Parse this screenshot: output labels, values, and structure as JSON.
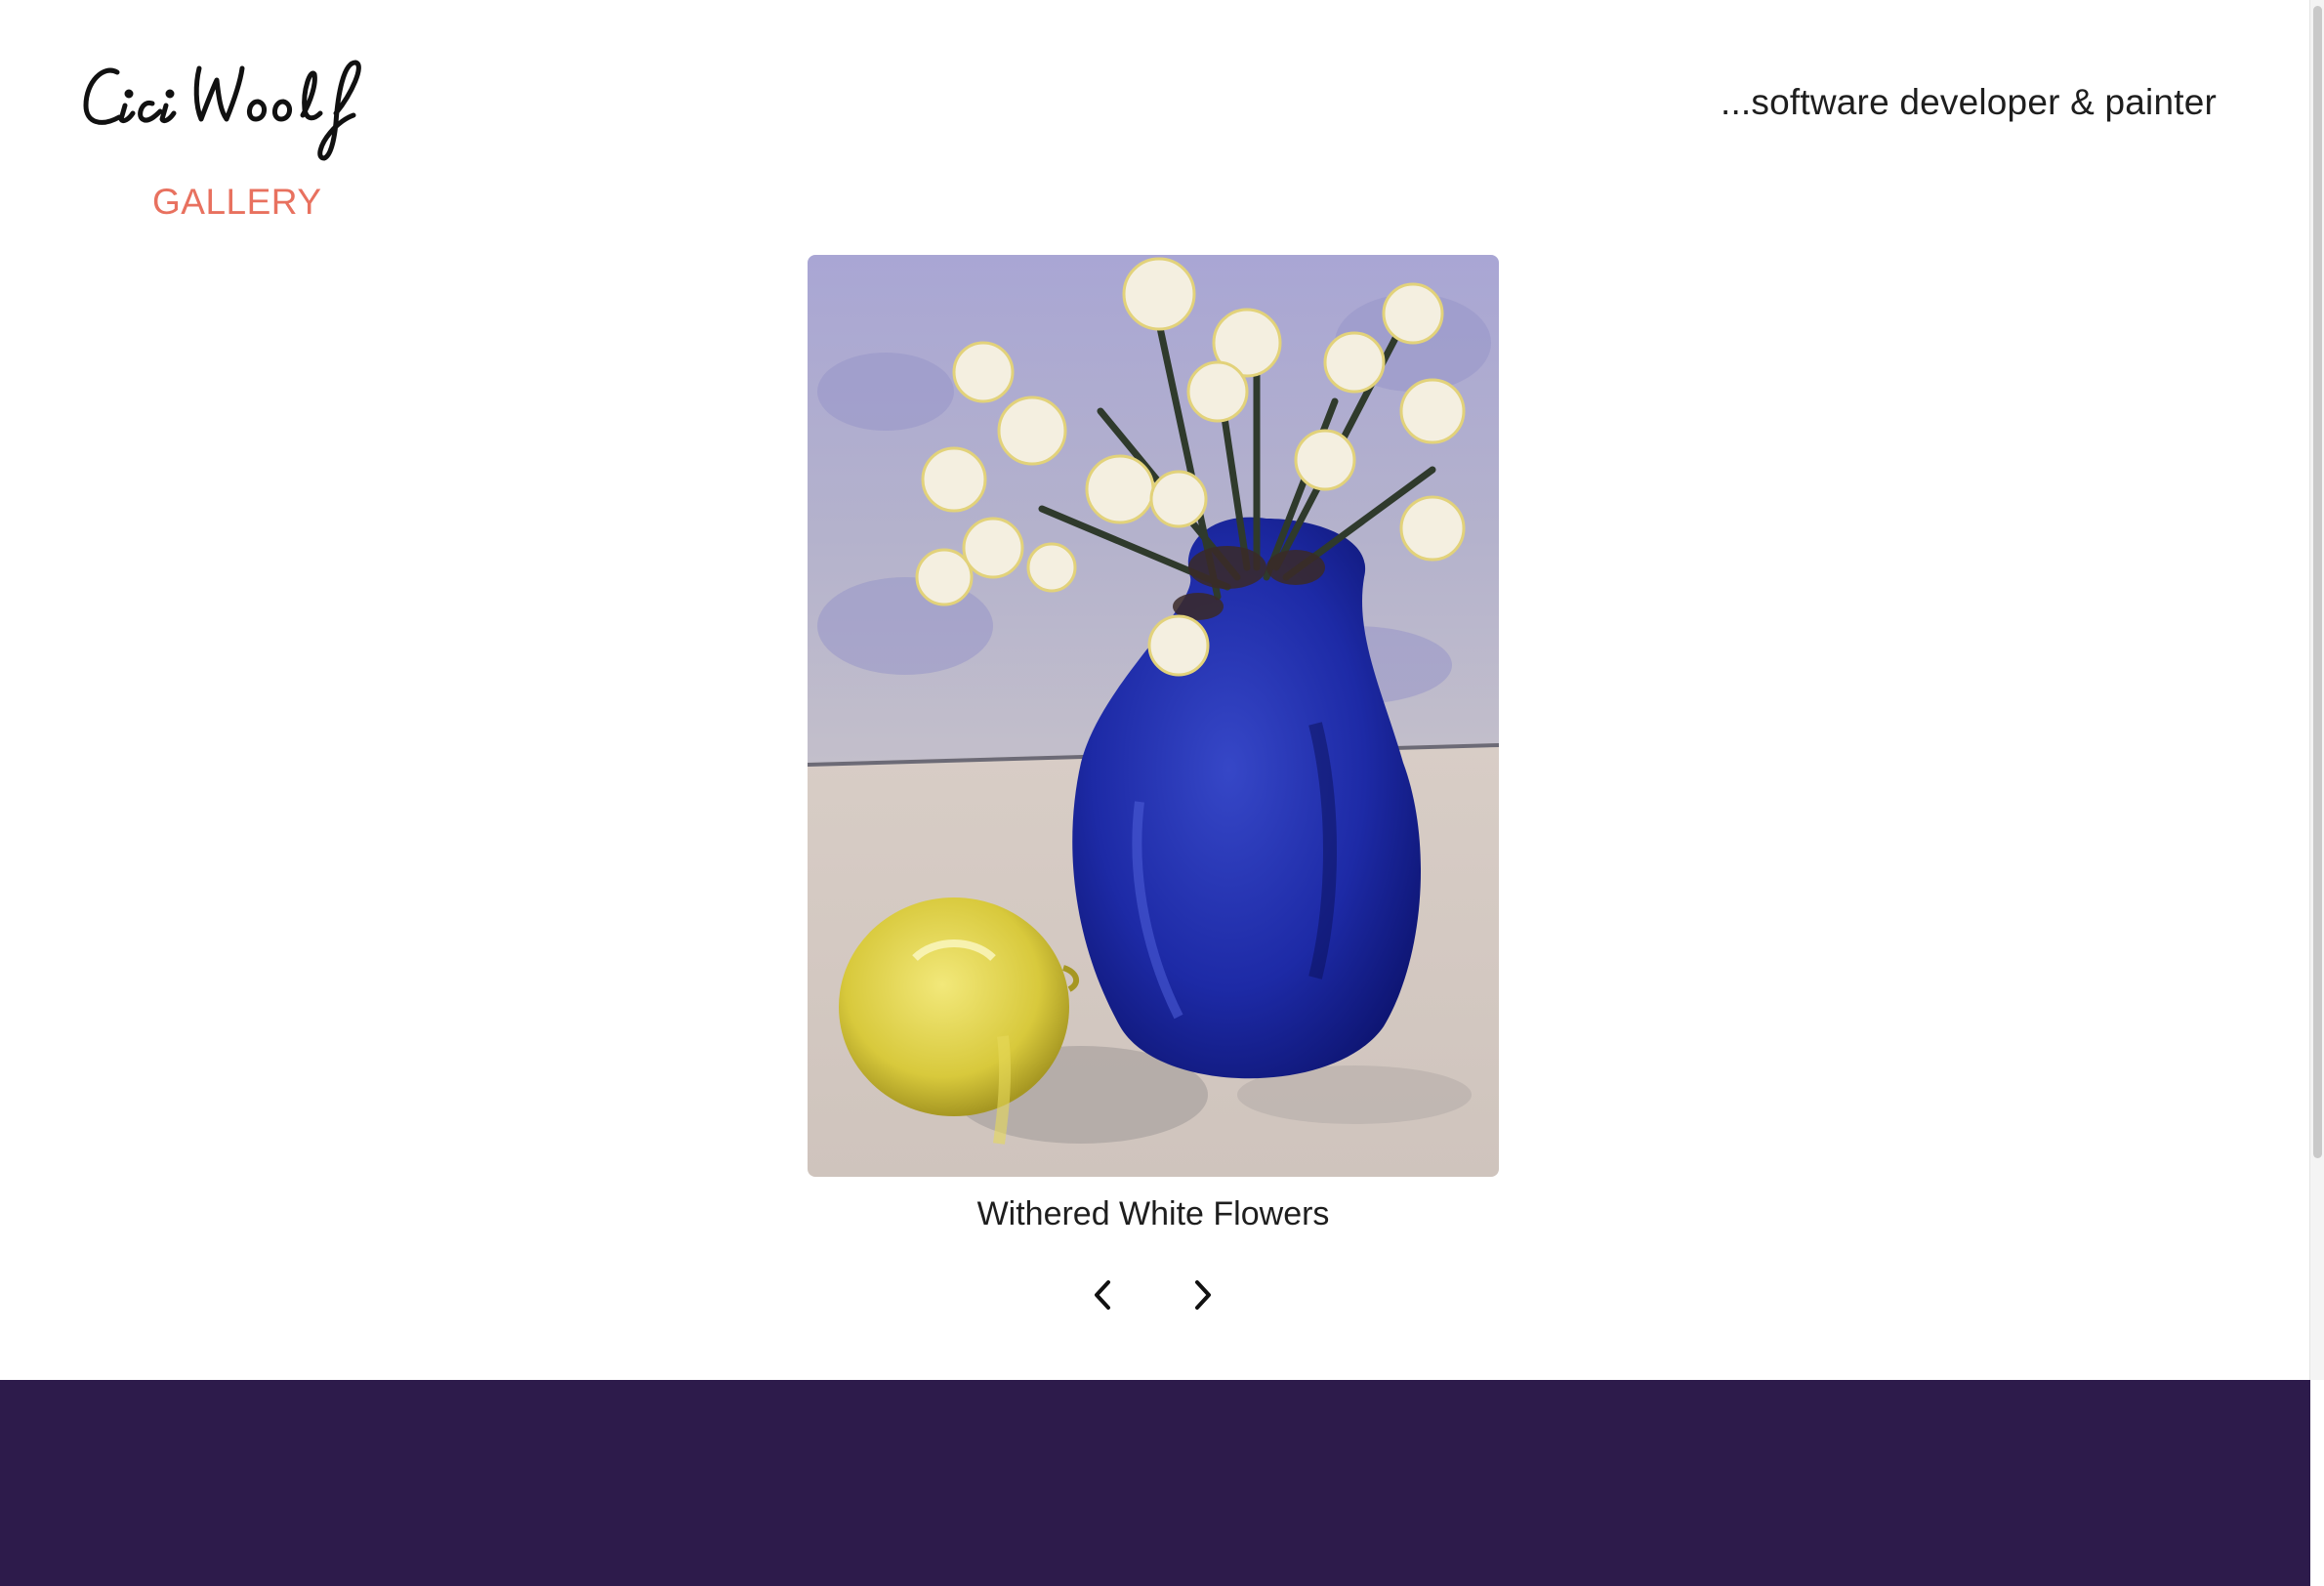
{
  "header": {
    "logo_text": "Cici Woolf",
    "tagline": "...software developer & painter"
  },
  "nav": {
    "gallery_label": "GALLERY"
  },
  "gallery": {
    "current_title": "Withered White Flowers",
    "prev_icon": "chevron-left-icon",
    "next_icon": "chevron-right-icon"
  },
  "colors": {
    "accent": "#e8715f",
    "footer": "#2d1b4b",
    "text": "#1e1e1e"
  }
}
